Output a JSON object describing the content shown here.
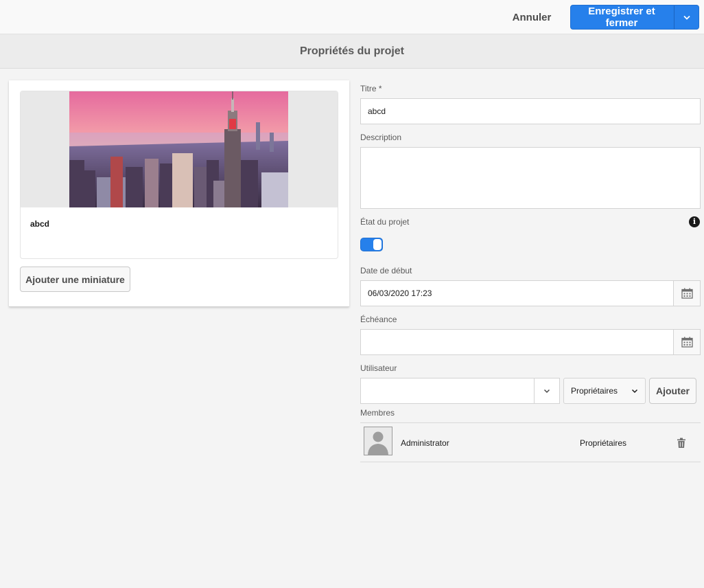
{
  "toolbar": {
    "cancel_label": "Annuler",
    "save_label": "Enregistrer et fermer",
    "accent": "#2680eb"
  },
  "header": {
    "title": "Propriétés du projet"
  },
  "thumbnail": {
    "title": "abcd",
    "image": "city-skyline-image",
    "add_button_label": "Ajouter une miniature"
  },
  "form": {
    "title_label": "Titre *",
    "title_value": "abcd",
    "description_label": "Description",
    "description_value": "",
    "status_label": "État du projet",
    "status_on": true,
    "start_label": "Date de début",
    "start_value": "06/03/2020 17:23",
    "due_label": "Échéance",
    "due_value": "",
    "user_label": "Utilisateur",
    "user_value": "",
    "role_selected": "Propriétaires",
    "add_label": "Ajouter",
    "members_label": "Membres"
  },
  "members": [
    {
      "name": "Administrator",
      "role": "Propriétaires"
    }
  ]
}
